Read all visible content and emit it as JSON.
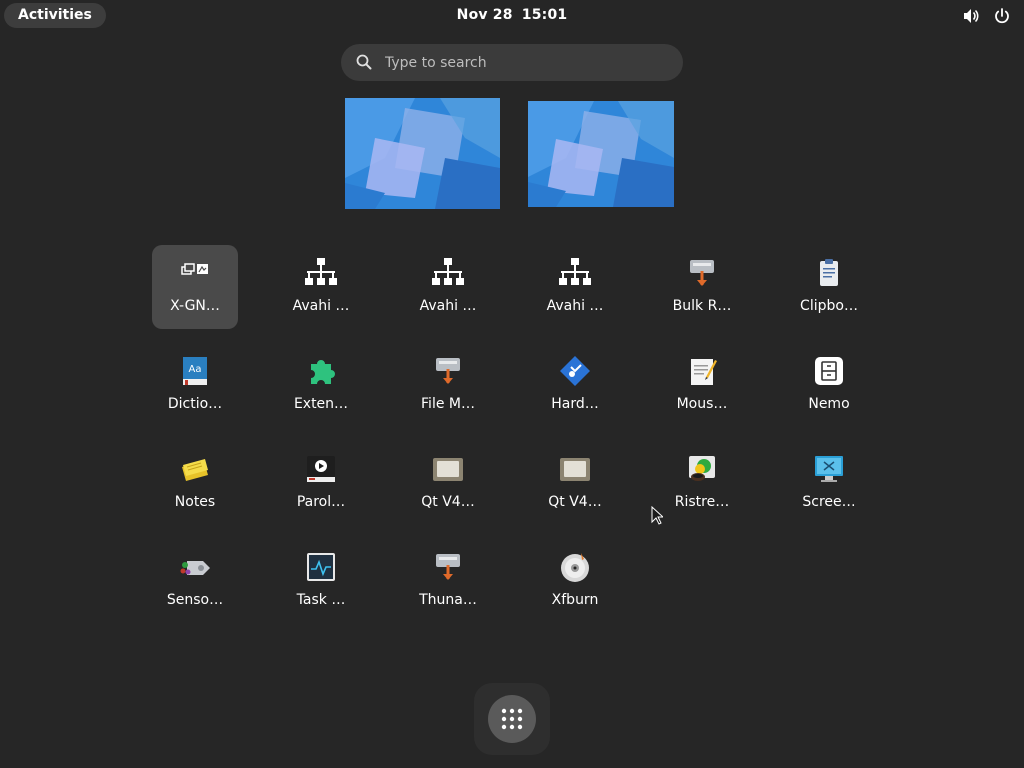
{
  "topbar": {
    "activities_label": "Activities",
    "date": "Nov 28",
    "time": "15:01",
    "icons": [
      "volume-icon",
      "power-icon"
    ]
  },
  "search": {
    "placeholder": "Type to search",
    "value": ""
  },
  "workspaces": [
    {
      "label": "workspace-1"
    },
    {
      "label": "workspace-2"
    }
  ],
  "apps": [
    {
      "label": "X-GN…",
      "icon": "xgnome-icon",
      "selected": true
    },
    {
      "label": "Avahi …",
      "icon": "network-icon"
    },
    {
      "label": "Avahi …",
      "icon": "network-icon"
    },
    {
      "label": "Avahi …",
      "icon": "network-icon"
    },
    {
      "label": "Bulk R…",
      "icon": "bulk-rename-icon"
    },
    {
      "label": "Clipbo…",
      "icon": "clipboard-icon"
    },
    {
      "label": "Dictio…",
      "icon": "dictionary-icon"
    },
    {
      "label": "Exten…",
      "icon": "extensions-icon"
    },
    {
      "label": "File M…",
      "icon": "file-manager-icon"
    },
    {
      "label": "Hard…",
      "icon": "hardinfo-icon"
    },
    {
      "label": "Mous…",
      "icon": "mousepad-icon"
    },
    {
      "label": "Nemo",
      "icon": "nemo-icon"
    },
    {
      "label": "Notes",
      "icon": "notes-icon"
    },
    {
      "label": "Parol…",
      "icon": "parole-icon"
    },
    {
      "label": "Qt V4…",
      "icon": "qt-v4l-icon"
    },
    {
      "label": "Qt V4…",
      "icon": "qt-v4l-icon"
    },
    {
      "label": "Ristre…",
      "icon": "ristretto-icon"
    },
    {
      "label": "Scree…",
      "icon": "screensaver-icon"
    },
    {
      "label": "Senso…",
      "icon": "sensors-icon"
    },
    {
      "label": "Task …",
      "icon": "task-manager-icon"
    },
    {
      "label": "Thuna…",
      "icon": "thunar-icon"
    },
    {
      "label": "Xfburn",
      "icon": "xfburn-icon"
    }
  ],
  "dash": {
    "show_apps_icon": "app-grid-icon"
  },
  "colors": {
    "background": "#262626",
    "tile_selected": "#4a4a4a",
    "search_bg": "#3b3b3b"
  }
}
